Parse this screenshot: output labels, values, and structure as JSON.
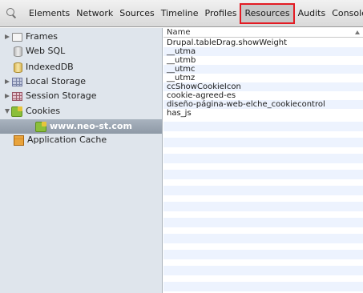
{
  "toolbar": {
    "tabs": [
      "Elements",
      "Network",
      "Sources",
      "Timeline",
      "Profiles",
      "Resources",
      "Audits",
      "Console"
    ],
    "selected_tab": "Resources"
  },
  "sidebar": {
    "frames": "Frames",
    "web_sql": "Web SQL",
    "indexeddb": "IndexedDB",
    "local_storage": "Local Storage",
    "session_storage": "Session Storage",
    "cookies": "Cookies",
    "cookie_domain": "www.neo-st.com",
    "app_cache": "Application Cache"
  },
  "table": {
    "header": "Name",
    "rows": [
      "Drupal.tableDrag.showWeight",
      "__utma",
      "__utmb",
      "__utmc",
      "__utmz",
      "ccShowCookieIcon",
      "cookie-agreed-es",
      "diseño-página-web-elche_cookiecontrol",
      "has_js"
    ]
  },
  "colors": {
    "highlight": "#e31b23",
    "sidebar_bg": "#dfe5ec",
    "alt_row": "#edf3fe"
  }
}
